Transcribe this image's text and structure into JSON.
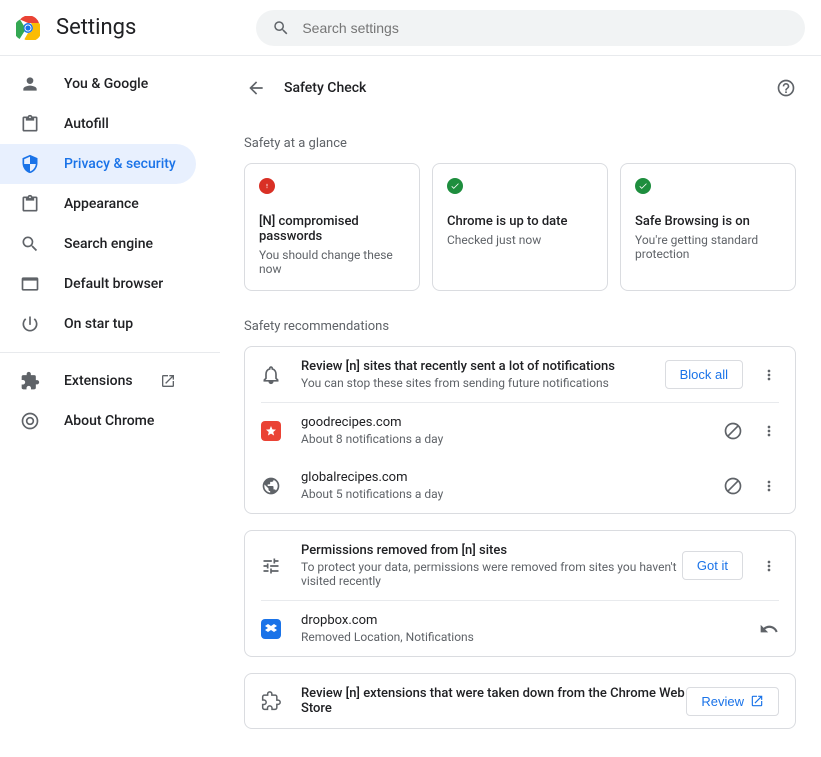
{
  "app_title": "Settings",
  "search": {
    "placeholder": "Search settings"
  },
  "sidebar": {
    "items": [
      {
        "label": "You & Google"
      },
      {
        "label": "Autofill"
      },
      {
        "label": "Privacy & security"
      },
      {
        "label": "Appearance"
      },
      {
        "label": "Search engine"
      },
      {
        "label": "Default browser"
      },
      {
        "label": "On star  tup"
      }
    ],
    "extensions_label": "Extensions",
    "about_label": "About Chrome"
  },
  "page": {
    "title": "Safety Check",
    "glance_heading": "Safety at a glance",
    "recs_heading": "Safety recommendations",
    "cards": [
      {
        "title": "[N] compromised passwords",
        "sub": "You should change these now"
      },
      {
        "title": "Chrome is up to date",
        "sub": "Checked just now"
      },
      {
        "title": "Safe Browsing is on",
        "sub": "You're getting standard protection"
      }
    ],
    "notif": {
      "title": "Review [n] sites that recently sent a lot of notifications",
      "sub": "You can stop these sites from sending future notifications",
      "block_all": "Block all",
      "sites": [
        {
          "name": "goodrecipes.com",
          "info": "About 8 notifications a day"
        },
        {
          "name": "globalrecipes.com",
          "info": "About 5 notifications a day"
        }
      ]
    },
    "perms": {
      "title": "Permissions removed from [n] sites",
      "sub": "To protect your data, permissions were removed from sites you haven't visited recently",
      "got_it": "Got it",
      "sites": [
        {
          "name": "dropbox.com",
          "info": "Removed Location, Notifications"
        }
      ]
    },
    "exts": {
      "title": "Review [n] extensions that were taken down from the Chrome Web Store",
      "review": "Review"
    }
  }
}
